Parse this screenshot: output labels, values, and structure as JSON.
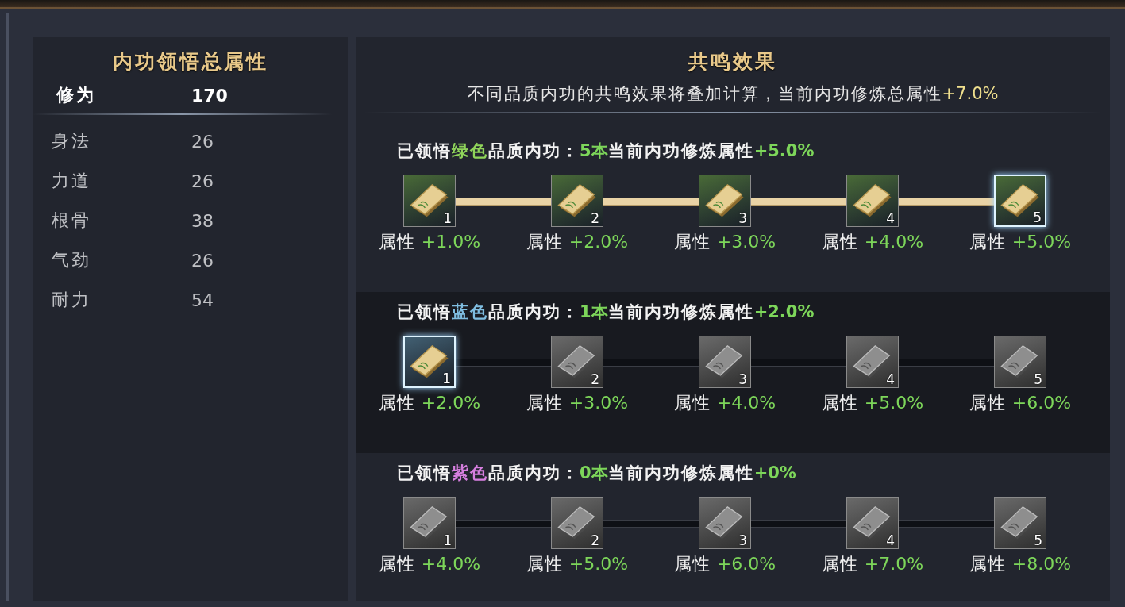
{
  "attributes_panel": {
    "title": "内功领悟总属性",
    "rows": [
      {
        "kind": "total",
        "name": "修为",
        "value": "170"
      },
      {
        "kind": "stat",
        "name": "身法",
        "value": "26"
      },
      {
        "kind": "stat",
        "name": "力道",
        "value": "26"
      },
      {
        "kind": "stat",
        "name": "根骨",
        "value": "38"
      },
      {
        "kind": "stat",
        "name": "气劲",
        "value": "26"
      },
      {
        "kind": "stat",
        "name": "耐力",
        "value": "54"
      }
    ]
  },
  "resonance_panel": {
    "title": "共鸣效果",
    "description": "不同品质内功的共鸣效果将叠加计算，当前内功修炼总属性",
    "total_bonus": "+7.0%",
    "tiers": [
      {
        "shaded": false,
        "color": "#8fd45a",
        "prefix": "已领悟",
        "quality": "绿色",
        "middle": "品质内功：",
        "count": "5本",
        "label": "当前内功修炼属性",
        "bonus": "+5.0%",
        "nodes": [
          {
            "number": "1",
            "effect_label": "属性",
            "effect_value": "+1.0%",
            "unlocked": true,
            "current": false
          },
          {
            "number": "2",
            "effect_label": "属性",
            "effect_value": "+2.0%",
            "unlocked": true,
            "current": false
          },
          {
            "number": "3",
            "effect_label": "属性",
            "effect_value": "+3.0%",
            "unlocked": true,
            "current": false
          },
          {
            "number": "4",
            "effect_label": "属性",
            "effect_value": "+4.0%",
            "unlocked": true,
            "current": false
          },
          {
            "number": "5",
            "effect_label": "属性",
            "effect_value": "+5.0%",
            "unlocked": true,
            "current": true
          }
        ]
      },
      {
        "shaded": true,
        "color": "#7fbde0",
        "prefix": "已领悟",
        "quality": "蓝色",
        "middle": "品质内功：",
        "count": "1本",
        "label": "当前内功修炼属性",
        "bonus": "+2.0%",
        "nodes": [
          {
            "number": "1",
            "effect_label": "属性",
            "effect_value": "+2.0%",
            "unlocked": true,
            "current": true
          },
          {
            "number": "2",
            "effect_label": "属性",
            "effect_value": "+3.0%",
            "unlocked": false,
            "current": false
          },
          {
            "number": "3",
            "effect_label": "属性",
            "effect_value": "+4.0%",
            "unlocked": false,
            "current": false
          },
          {
            "number": "4",
            "effect_label": "属性",
            "effect_value": "+5.0%",
            "unlocked": false,
            "current": false
          },
          {
            "number": "5",
            "effect_label": "属性",
            "effect_value": "+6.0%",
            "unlocked": false,
            "current": false
          }
        ]
      },
      {
        "shaded": false,
        "color": "#d77fe0",
        "prefix": "已领悟",
        "quality": "紫色",
        "middle": "品质内功：",
        "count": "0本",
        "label": "当前内功修炼属性",
        "bonus": "+0%",
        "nodes": [
          {
            "number": "1",
            "effect_label": "属性",
            "effect_value": "+4.0%",
            "unlocked": false,
            "current": false
          },
          {
            "number": "2",
            "effect_label": "属性",
            "effect_value": "+5.0%",
            "unlocked": false,
            "current": false
          },
          {
            "number": "3",
            "effect_label": "属性",
            "effect_value": "+6.0%",
            "unlocked": false,
            "current": false
          },
          {
            "number": "4",
            "effect_label": "属性",
            "effect_value": "+7.0%",
            "unlocked": false,
            "current": false
          },
          {
            "number": "5",
            "effect_label": "属性",
            "effect_value": "+8.0%",
            "unlocked": false,
            "current": false
          }
        ]
      }
    ]
  }
}
